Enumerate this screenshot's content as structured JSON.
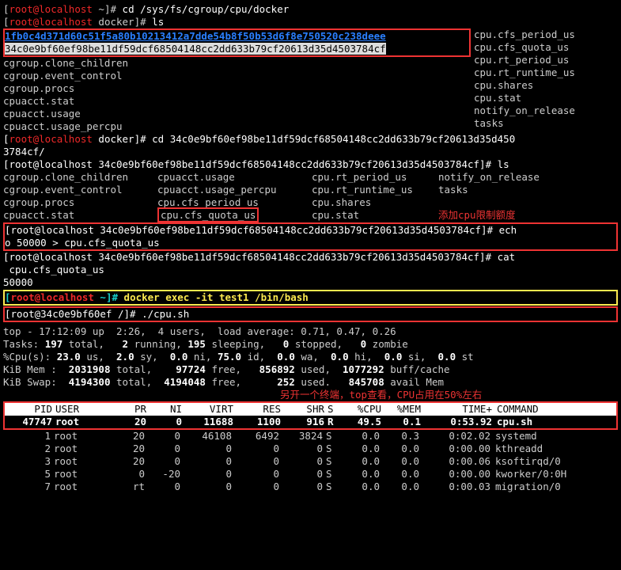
{
  "cd_line": {
    "prompt_open": "[",
    "user_host": "root@localhost",
    "path": " ~",
    "prompt_close": "]#",
    "cmd": " cd /sys/fs/cgroup/cpu/docker"
  },
  "ls_line": {
    "prompt_open": "[",
    "user_host": "root@localhost",
    "path": " docker",
    "prompt_close": "]#",
    "cmd": " ls"
  },
  "hash_box": {
    "line1": "1fb0c4d371d60c51f5a80b10213412a7dde54b8f50b53d6f8e750520c238deee",
    "line2": "34c0e9bf60ef98be11df59dcf68504148cc2dd633b79cf20613d35d4503784cf"
  },
  "right_col": [
    "cpu.cfs_period_us",
    "cpu.cfs_quota_us",
    "cpu.rt_period_us",
    "cpu.rt_runtime_us",
    "cpu.shares",
    "cpu.stat",
    "notify_on_release",
    "tasks"
  ],
  "left_col": [
    "cgroup.clone_children",
    "cgroup.event_control",
    "cgroup.procs",
    "cpuacct.stat",
    "cpuacct.usage",
    "cpuacct.usage_percpu"
  ],
  "cd_hash": {
    "prompt": "[root@localhost docker]#",
    "cmd": " cd 34c0e9bf60ef98be11df59dcf68504148cc2dd633b79cf20613d35d4503784cf/",
    "wrap": "3784cf/"
  },
  "ls_hash": {
    "prompt": "[root@localhost 34c0e9bf60ef98be11df59dcf68504148cc2dd633b79cf20613d35d4503784cf]#",
    "cmd": " ls"
  },
  "ls_out": {
    "c1": [
      "cgroup.clone_children",
      "cgroup.event_control",
      "cgroup.procs",
      "cpuacct.stat"
    ],
    "c2": [
      "cpuacct.usage",
      "cpuacct.usage_percpu",
      "cpu.cfs_period_us",
      "cpu.cfs_quota_us"
    ],
    "c3": [
      "cpu.rt_period_us",
      "cpu.rt_runtime_us",
      "cpu.shares",
      "cpu.stat"
    ],
    "c4": [
      "notify_on_release",
      "tasks",
      "",
      ""
    ]
  },
  "anno1": "添加cpu限制额度",
  "echo_line": {
    "prompt": "[root@localhost 34c0e9bf60ef98be11df59dcf68504148cc2dd633b79cf20613d35d4503784cf]#",
    "cmd": " echo 50000 > cpu.cfs_quota_us",
    "wrap_a": "o 50000 > cpu.cfs_quota_us"
  },
  "cat_line": {
    "prompt": "[root@localhost 34c0e9bf60ef98be11df59dcf68504148cc2dd633b79cf20613d35d4503784cf]#",
    "cmd_a": " cat",
    "wrap_a": " cpu.cfs_quota_us",
    "out": "50000"
  },
  "docker_exec": {
    "prompt_open": "[",
    "user_host": "root@localhost",
    "path": " ~",
    "prompt_close": "]#",
    "cmd": " docker exec -it test1 /bin/bash"
  },
  "cpu_sh": {
    "prompt": "[root@34c0e9bf60ef /]#",
    "cmd": " ./cpu.sh"
  },
  "top_header": {
    "l1": "top - 17:12:09 up  2:26,  4 users,  load average: 0.71, 0.47, 0.26",
    "l2_a": "Tasks: ",
    "l2_b": "197 ",
    "l2_c": "total,   ",
    "l2_d": "2 ",
    "l2_e": "running, ",
    "l2_f": "195 ",
    "l2_g": "sleeping,   ",
    "l2_h": "0 ",
    "l2_i": "stopped,   ",
    "l2_j": "0 ",
    "l2_k": "zombie",
    "l3": "%Cpu(s): 23.0 us,  2.0 sy,  0.0 ni, 75.0 id,  0.0 wa,  0.0 hi,  0.0 si,  0.0 st",
    "l4": "KiB Mem :  2031908 total,    97724 free,   856892 used,  1077292 buff/cache",
    "l5": "KiB Swap:  4194300 total,  4194048 free,      252 used.   845708 avail Mem"
  },
  "anno2": "另开一个终端，top查看，CPU占用在50%左右",
  "columns": [
    "PID",
    "USER",
    "PR",
    "NI",
    "VIRT",
    "RES",
    "SHR",
    "S",
    "%CPU",
    "%MEM",
    "TIME+",
    "COMMAND"
  ],
  "rows": [
    {
      "pid": "47747",
      "user": "root",
      "pr": "20",
      "ni": "0",
      "virt": "11688",
      "res": "1100",
      "shr": "916",
      "s": "R",
      "cpu": "49.5",
      "mem": "0.1",
      "time": "0:53.92",
      "cmd": "cpu.sh",
      "hl": true
    },
    {
      "pid": "1",
      "user": "root",
      "pr": "20",
      "ni": "0",
      "virt": "46108",
      "res": "6492",
      "shr": "3824",
      "s": "S",
      "cpu": "0.0",
      "mem": "0.3",
      "time": "0:02.02",
      "cmd": "systemd"
    },
    {
      "pid": "2",
      "user": "root",
      "pr": "20",
      "ni": "0",
      "virt": "0",
      "res": "0",
      "shr": "0",
      "s": "S",
      "cpu": "0.0",
      "mem": "0.0",
      "time": "0:00.00",
      "cmd": "kthreadd"
    },
    {
      "pid": "3",
      "user": "root",
      "pr": "20",
      "ni": "0",
      "virt": "0",
      "res": "0",
      "shr": "0",
      "s": "S",
      "cpu": "0.0",
      "mem": "0.0",
      "time": "0:00.06",
      "cmd": "ksoftirqd/0"
    },
    {
      "pid": "5",
      "user": "root",
      "pr": "0",
      "ni": "-20",
      "virt": "0",
      "res": "0",
      "shr": "0",
      "s": "S",
      "cpu": "0.0",
      "mem": "0.0",
      "time": "0:00.00",
      "cmd": "kworker/0:0H"
    },
    {
      "pid": "7",
      "user": "root",
      "pr": "rt",
      "ni": "0",
      "virt": "0",
      "res": "0",
      "shr": "0",
      "s": "S",
      "cpu": "0.0",
      "mem": "0.0",
      "time": "0:00.03",
      "cmd": "migration/0"
    }
  ]
}
